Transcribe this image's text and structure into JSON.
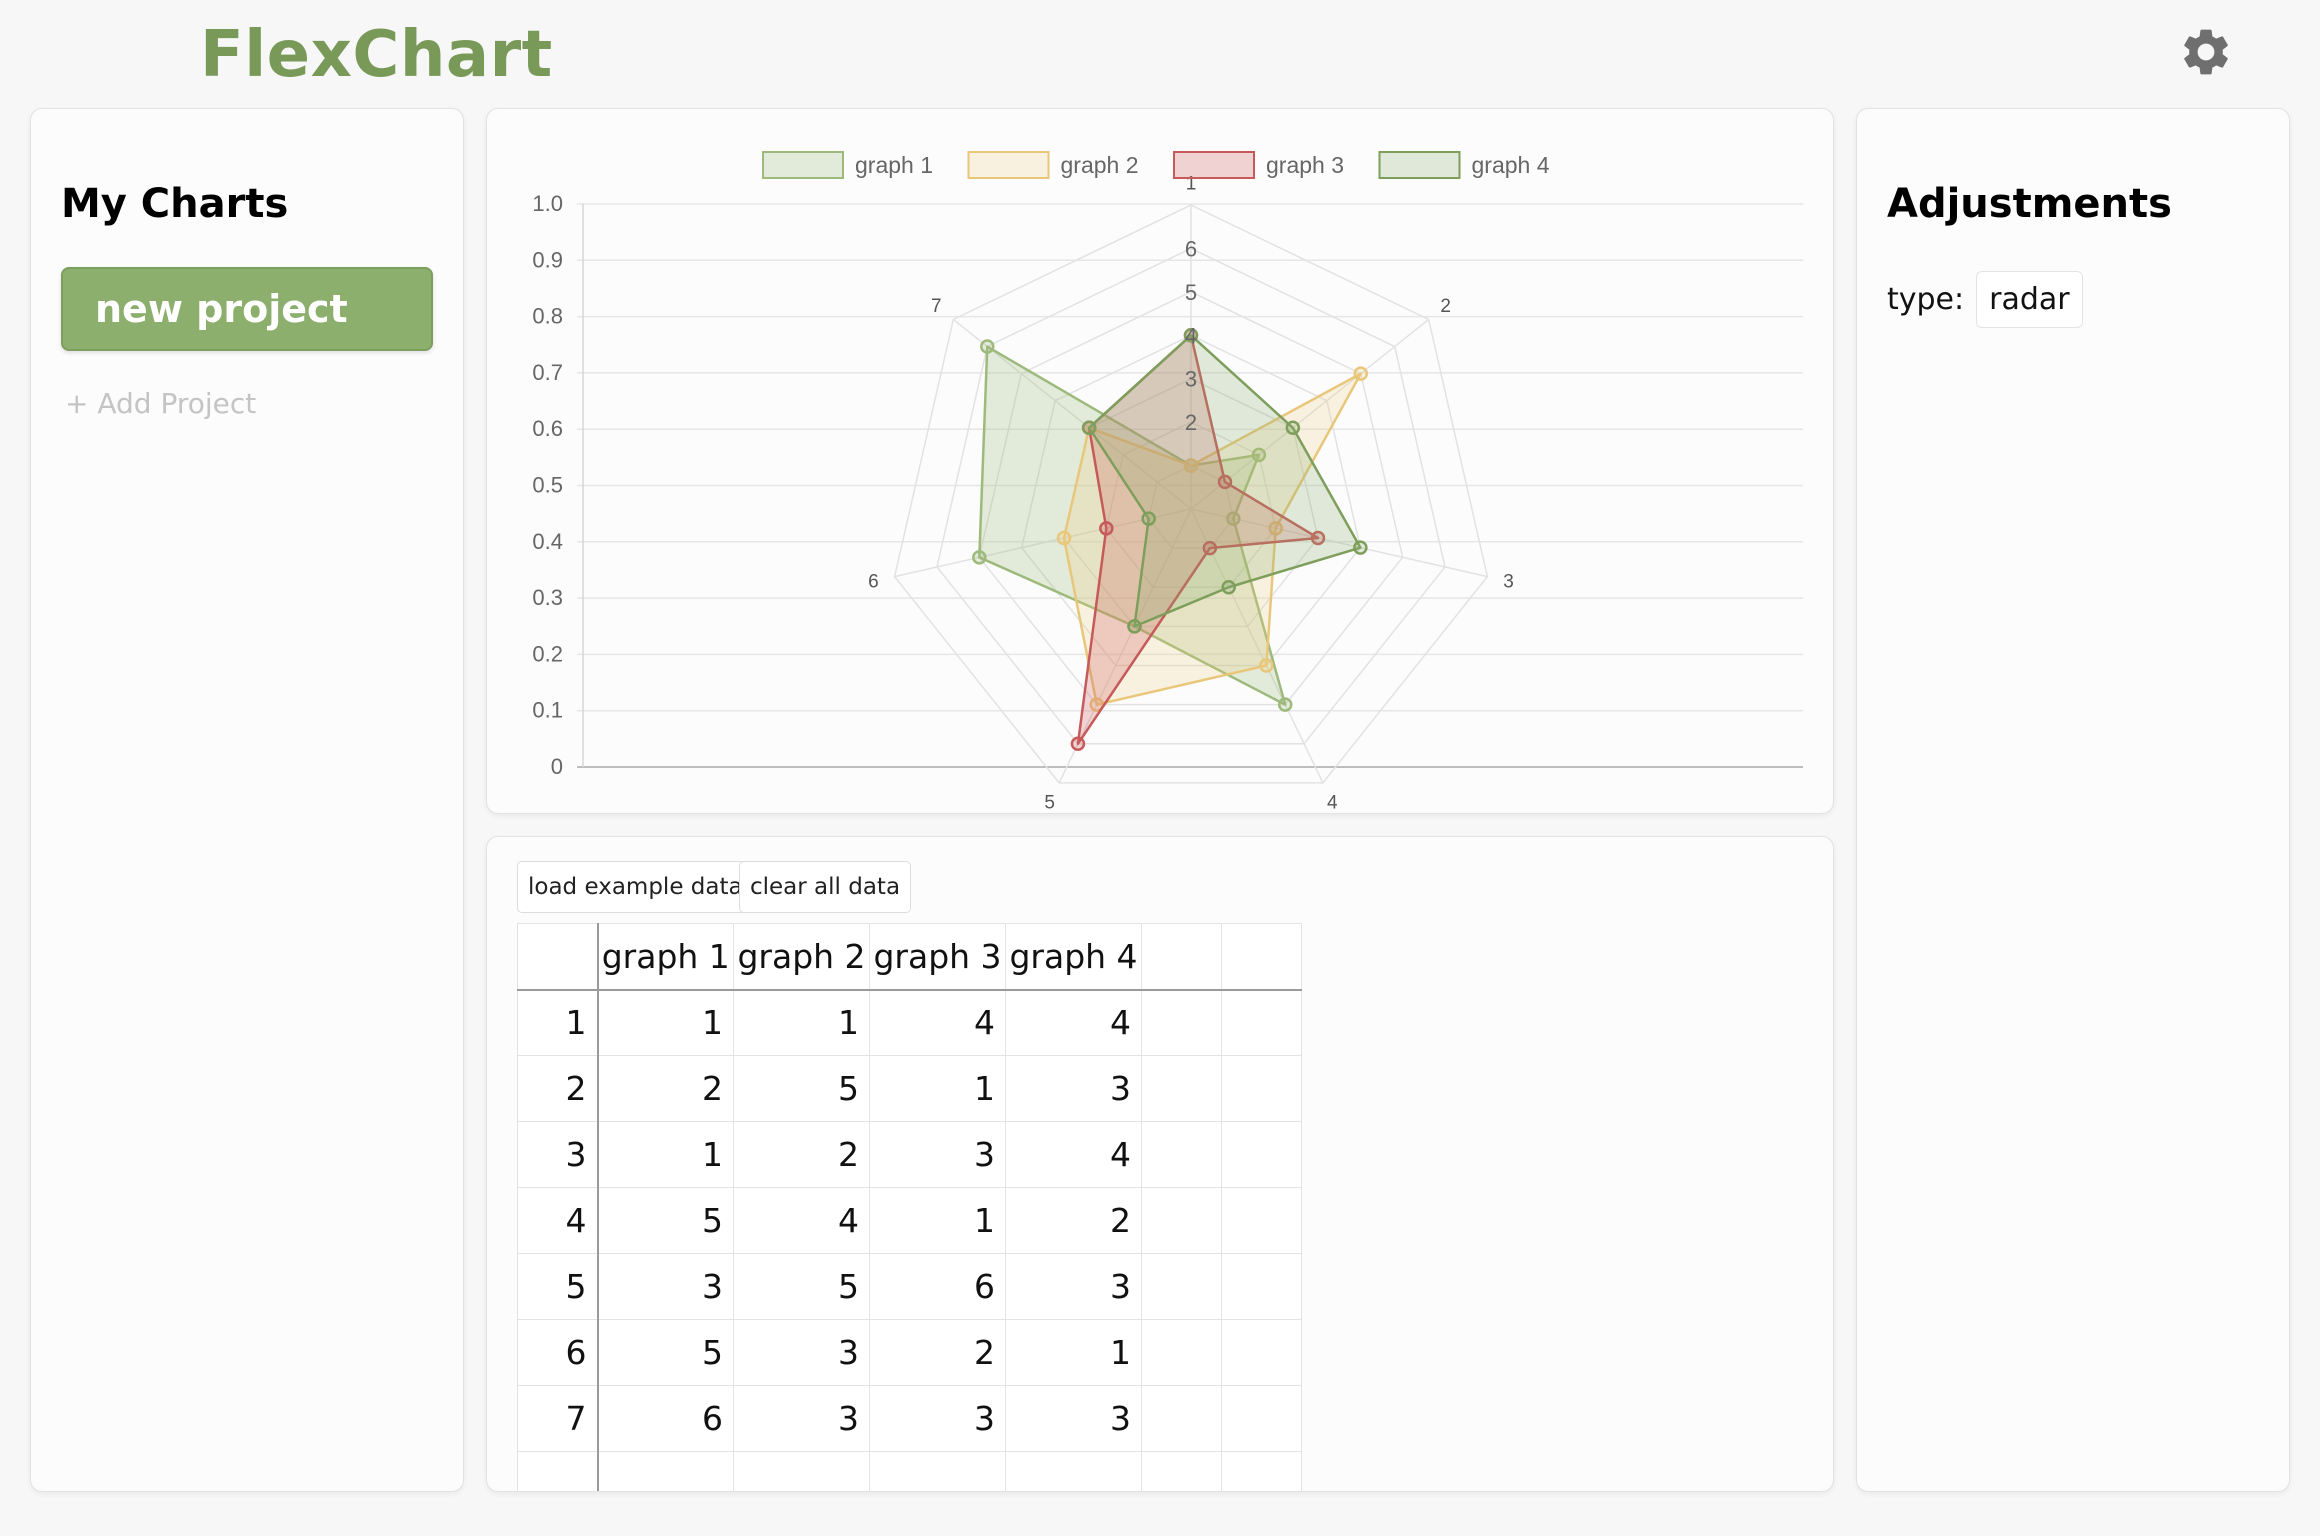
{
  "app": {
    "title": "FlexChart"
  },
  "icons": {
    "settings": "gear-icon"
  },
  "colors": {
    "brand": "#799959",
    "button": "#8daf6d"
  },
  "sidebar": {
    "heading": "My Charts",
    "project_label": "new project",
    "add_project_label": "+ Add Project"
  },
  "adjustments": {
    "heading": "Adjustments",
    "type_label": "type:",
    "type_value": "radar"
  },
  "toolbar": {
    "load_label": "load example data",
    "clear_label": "clear all data"
  },
  "table": {
    "columns": [
      "graph 1",
      "graph 2",
      "graph 3",
      "graph 4"
    ],
    "rows": [
      {
        "index": "1",
        "cells": [
          "1",
          "1",
          "4",
          "4"
        ]
      },
      {
        "index": "2",
        "cells": [
          "2",
          "5",
          "1",
          "3"
        ]
      },
      {
        "index": "3",
        "cells": [
          "1",
          "2",
          "3",
          "4"
        ]
      },
      {
        "index": "4",
        "cells": [
          "5",
          "4",
          "1",
          "2"
        ]
      },
      {
        "index": "5",
        "cells": [
          "3",
          "5",
          "6",
          "3"
        ]
      },
      {
        "index": "6",
        "cells": [
          "5",
          "3",
          "2",
          "1"
        ]
      },
      {
        "index": "7",
        "cells": [
          "6",
          "3",
          "3",
          "3"
        ]
      }
    ]
  },
  "chart_data": {
    "type": "radar",
    "categories": [
      "1",
      "2",
      "3",
      "4",
      "5",
      "6",
      "7"
    ],
    "series": [
      {
        "name": "graph 1",
        "values": [
          1,
          2,
          1,
          5,
          3,
          5,
          6
        ],
        "stroke": "#9dba7c",
        "fill": "rgba(157,186,124,0.28)"
      },
      {
        "name": "graph 2",
        "values": [
          1,
          5,
          2,
          4,
          5,
          3,
          3
        ],
        "stroke": "#e8c77a",
        "fill": "rgba(240,205,125,0.22)"
      },
      {
        "name": "graph 3",
        "values": [
          4,
          1,
          3,
          1,
          6,
          2,
          3
        ],
        "stroke": "#c65a5a",
        "fill": "rgba(210,100,100,0.28)"
      },
      {
        "name": "graph 4",
        "values": [
          4,
          3,
          4,
          2,
          3,
          1,
          3
        ],
        "stroke": "#7e9e5c",
        "fill": "rgba(140,175,110,0.25)"
      }
    ],
    "radial_ticks": [
      "2",
      "3",
      "4",
      "5",
      "6"
    ],
    "y_ticks": [
      "0",
      "0.1",
      "0.2",
      "0.3",
      "0.4",
      "0.5",
      "0.6",
      "0.7",
      "0.8",
      "0.9",
      "1.0"
    ],
    "ylim": [
      0,
      1
    ],
    "legend_position": "top",
    "grid": true
  }
}
